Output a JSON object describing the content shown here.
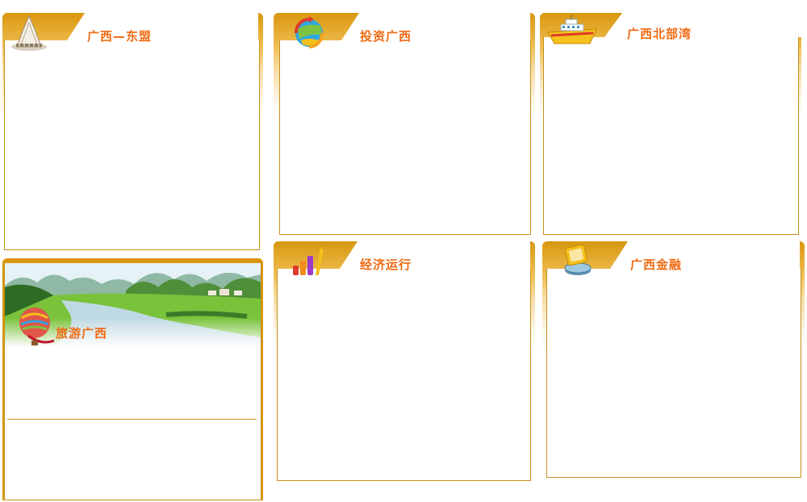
{
  "panels": {
    "asean": {
      "title": "广西—东盟",
      "icon": "stadium-icon"
    },
    "invest": {
      "title": "投资广西",
      "icon": "globe-icon"
    },
    "gulf": {
      "title": "广西北部湾",
      "icon": "ship-icon"
    },
    "tourism": {
      "title": "旅游广西",
      "icon": "hot-air-balloon-icon"
    },
    "economy": {
      "title": "经济运行",
      "icon": "bar-chart-icon"
    },
    "finance": {
      "title": "广西金融",
      "icon": "coin-icon"
    }
  },
  "colors": {
    "accent": "#f06a12",
    "border": "#c4901a",
    "header": "#d9970e"
  }
}
